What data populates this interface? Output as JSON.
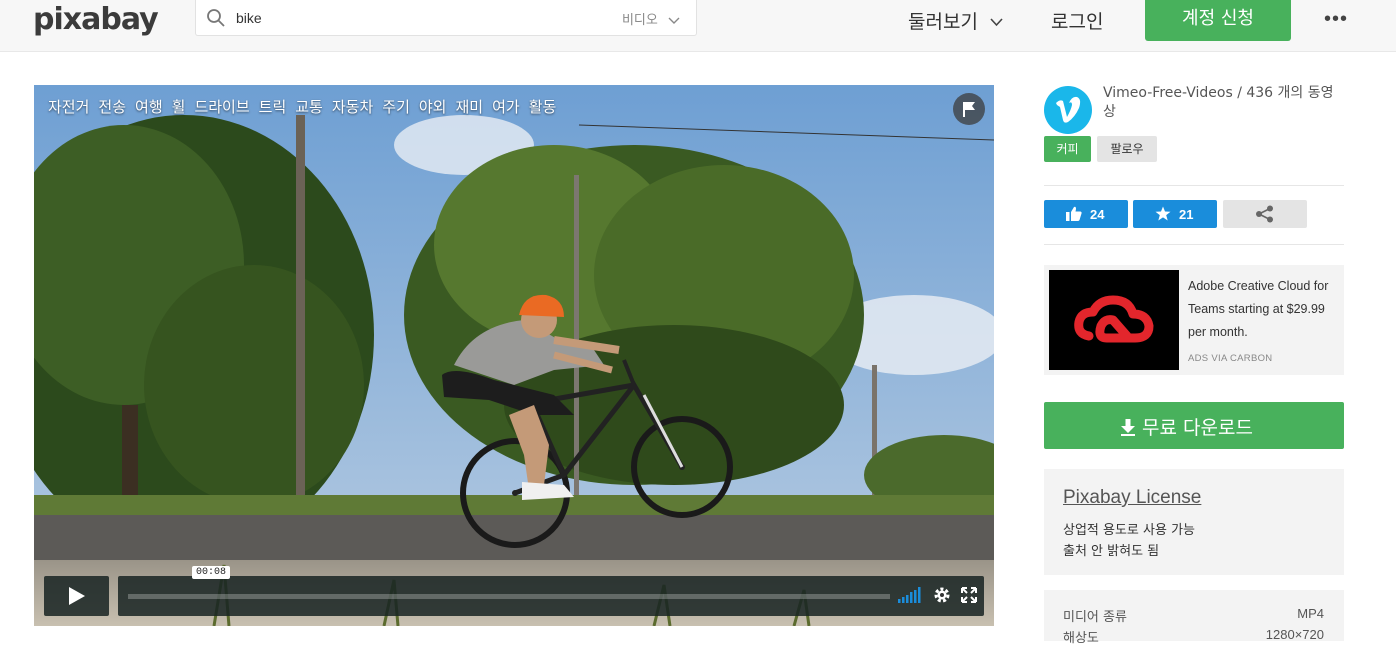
{
  "header": {
    "logo": "pixabay",
    "search_value": "bike",
    "search_filter": "비디오",
    "explore": "둘러보기",
    "login": "로그인",
    "signup": "계정 신청"
  },
  "video": {
    "tags": [
      "자전거",
      "전송",
      "여행",
      "휠",
      "드라이브",
      "트릭",
      "교통",
      "자동차",
      "주기",
      "야외",
      "재미",
      "여가",
      "활동"
    ],
    "current_time": "00:08",
    "progress": 0.0
  },
  "author": {
    "name_line": "Vimeo-Free-Videos / 436 개의 동영상",
    "coffee": "커피",
    "follow": "팔로우"
  },
  "actions": {
    "likes": "24",
    "favorites": "21"
  },
  "ad": {
    "text": "Adobe Creative Cloud for Teams starting at $29.99 per month.",
    "via": "ADS VIA CARBON"
  },
  "download": {
    "label": "무료 다운로드"
  },
  "license": {
    "title": "Pixabay License",
    "line1": "상업적 용도로 사용 가능",
    "line2": "출처 안 밝혀도 됨"
  },
  "meta": {
    "media_type_label": "미디어 종류",
    "media_type_value": "MP4",
    "resolution_label": "해상도",
    "resolution_value": "1280×720"
  },
  "colors": {
    "green": "#48b15c",
    "blue": "#1a8ddb",
    "vimeo": "#1ab7ea"
  }
}
